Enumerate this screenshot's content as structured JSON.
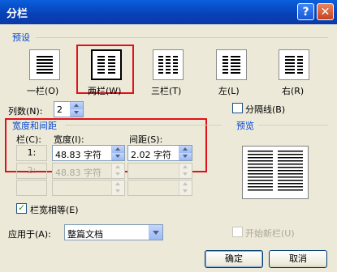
{
  "window": {
    "title": "分栏",
    "help_glyph": "?",
    "close_glyph": "✕"
  },
  "presets": {
    "group_label": "预设",
    "items": [
      {
        "label": "一栏(O)",
        "icon": "one-column-icon"
      },
      {
        "label": "两栏(W)",
        "icon": "two-columns-icon"
      },
      {
        "label": "三栏(T)",
        "icon": "three-columns-icon"
      },
      {
        "label": "左(L)",
        "icon": "left-column-icon"
      },
      {
        "label": "右(R)",
        "icon": "right-column-icon"
      }
    ]
  },
  "num_columns": {
    "label": "列数(N):",
    "value": "2"
  },
  "separator": {
    "label": "分隔线(B)",
    "checked": false
  },
  "width_spacing": {
    "group_label": "宽度和间距",
    "col_header": "栏(C):",
    "width_header": "宽度(I):",
    "spacing_header": "间距(S):",
    "rows": [
      {
        "col": "1:",
        "width": "48.83 字符",
        "spacing": "2.02 字符",
        "enabled": true
      },
      {
        "col": "2:",
        "width": "48.83 字符",
        "spacing": "",
        "enabled": false
      },
      {
        "col": "",
        "width": "",
        "spacing": "",
        "enabled": false
      }
    ]
  },
  "equal_width": {
    "label": "栏宽相等(E)",
    "checked": true
  },
  "preview": {
    "label": "预览"
  },
  "apply_to": {
    "label": "应用于(A):",
    "value": "整篇文档"
  },
  "new_column": {
    "label": "开始新栏(U)",
    "checked": false
  },
  "buttons": {
    "ok": "确定",
    "cancel": "取消"
  },
  "colors": {
    "accent": "#0046d5",
    "highlight": "#e1101a"
  }
}
